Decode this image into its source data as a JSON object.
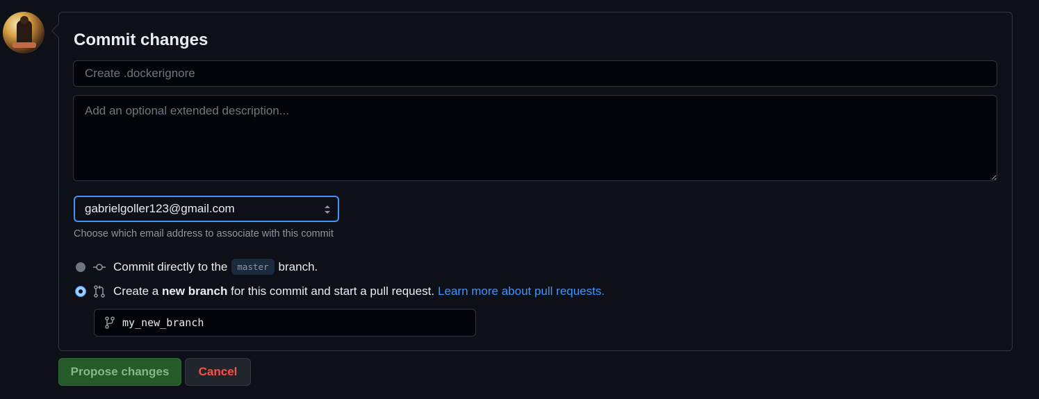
{
  "user": {
    "avatar_alt": "User avatar"
  },
  "commit": {
    "title": "Commit changes",
    "summary": {
      "value": "",
      "placeholder": "Create .dockerignore"
    },
    "description": {
      "value": "",
      "placeholder": "Add an optional extended description..."
    },
    "email": {
      "selected": "gabrielgoller123@gmail.com",
      "note": "Choose which email address to associate with this commit"
    },
    "options": [
      {
        "selected": false,
        "icon": "git-commit-icon",
        "prefix": "Commit directly to the",
        "branch": "master",
        "suffix": "branch."
      },
      {
        "selected": true,
        "icon": "git-pull-request-icon",
        "prefix": "Create a",
        "bold": "new branch",
        "suffix": "for this commit and start a pull request.",
        "link": "Learn more about pull requests."
      }
    ],
    "new_branch": {
      "value": "my_new_branch",
      "icon": "git-branch-icon"
    }
  },
  "actions": {
    "propose_label": "Propose changes",
    "cancel_label": "Cancel"
  },
  "colors": {
    "background": "#0d1117",
    "accent": "#4493f8",
    "primary_button": "#275a2b",
    "danger_text": "#f85149"
  }
}
